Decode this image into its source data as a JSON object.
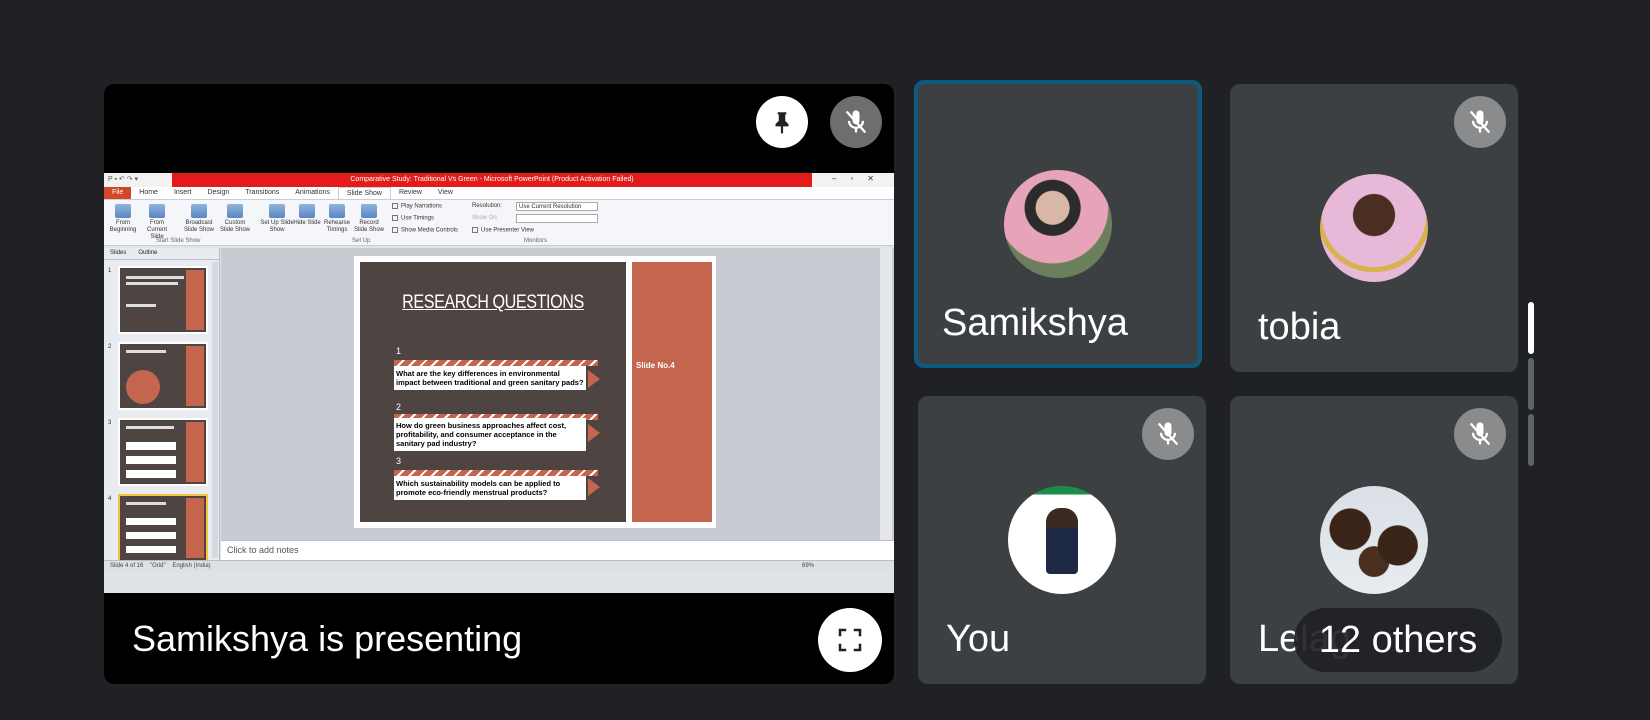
{
  "presentation": {
    "presenting_label": "Samikshya is presenting",
    "ppt": {
      "window_title": "Comparative Study: Traditional Vs Green - Microsoft PowerPoint (Product Activation Failed)",
      "tabs": [
        "File",
        "Home",
        "Insert",
        "Design",
        "Transitions",
        "Animations",
        "Slide Show",
        "Review",
        "View"
      ],
      "ribbon": {
        "from_beginning": "From Beginning",
        "from_current": "From Current Slide",
        "broadcast": "Broadcast Slide Show",
        "custom": "Custom Slide Show",
        "setup": "Set Up Slide Show",
        "hide": "Hide Slide",
        "rehearse": "Rehearse Timings",
        "record": "Record Slide Show",
        "play_narrations": "Play Narrations",
        "use_timings": "Use Timings",
        "show_media": "Show Media Controls",
        "resolution_label": "Resolution:",
        "resolution_value": "Use Current Resolution",
        "show_on": "Show On:",
        "presenter_view": "Use Presenter View",
        "group_start": "Start Slide Show",
        "group_setup": "Set Up",
        "group_monitors": "Monitors"
      },
      "left_tabs": [
        "Slides",
        "Outline"
      ],
      "thumb_numbers": [
        "1",
        "2",
        "3",
        "4"
      ],
      "slide": {
        "title": "RESEARCH QUESTIONS",
        "side_label": "Slide No.4",
        "questions": [
          {
            "num": "1",
            "text": "What are the key differences in environmental impact between traditional and green sanitary pads?"
          },
          {
            "num": "2",
            "text": "How do green business approaches affect cost, profitability, and consumer acceptance in the sanitary pad industry?"
          },
          {
            "num": "3",
            "text": "Which sustainability models can be applied to promote eco-friendly menstrual products?"
          }
        ]
      },
      "notes_placeholder": "Click to add notes",
      "status": {
        "slide": "Slide 4 of 16",
        "theme": "\"Grid\"",
        "language": "English (India)",
        "zoom": "69%"
      }
    }
  },
  "participants": [
    {
      "name": "Samikshya",
      "active": true,
      "muted": false
    },
    {
      "name": "tobia",
      "active": false,
      "muted": true
    },
    {
      "name": "You",
      "active": false,
      "muted": true
    },
    {
      "name": "Lelag",
      "active": false,
      "muted": true
    }
  ],
  "others_label": "12 others",
  "colors": {
    "background": "#202124",
    "tile": "#3c4043",
    "active_border": "#0b5b80",
    "slide_brown": "#4e4542",
    "slide_accent": "#c4664e"
  }
}
